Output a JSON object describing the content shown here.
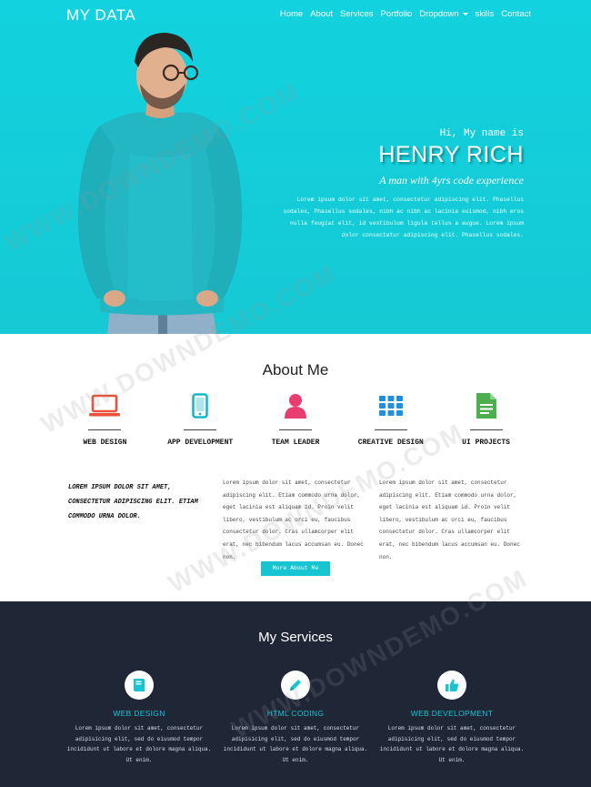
{
  "brand": "MY DATA",
  "nav": [
    {
      "label": "Home"
    },
    {
      "label": "About"
    },
    {
      "label": "Services"
    },
    {
      "label": "Portfolio"
    },
    {
      "label": "Dropdown"
    },
    {
      "label": "skills"
    },
    {
      "label": "Contact"
    }
  ],
  "hero": {
    "greeting": "Hi, My name is",
    "name": "HENRY RICH",
    "tagline": "A man with 4yrs code experience",
    "body": "Lorem ipsum dolor sit amet, consectetur adipiscing elit. Phasellus sodales, Phasellus sodales, nibh ac nibh ac lacinia euismod, nibh eros nulla feugiat elit, id vestibulum ligula tellus a augue. Lorem ipsum dolor consectetur adipiscing elit. Phasellus sodales."
  },
  "about": {
    "title": "About Me",
    "skills": [
      {
        "label": "WEB DESIGN",
        "icon": "laptop-icon",
        "color": "#e8523a"
      },
      {
        "label": "APP DEVELOPMENT",
        "icon": "smartphone-icon",
        "color": "#19b8c9"
      },
      {
        "label": "TEAM LEADER",
        "icon": "user-icon",
        "color": "#e83d6f"
      },
      {
        "label": "CREATIVE DESIGN",
        "icon": "grid-icon",
        "color": "#1f8fdf"
      },
      {
        "label": "UI PROJECTS",
        "icon": "document-icon",
        "color": "#4cae4f"
      }
    ],
    "lead": "LOREM IPSUM DOLOR SIT AMET, CONSECTETUR ADIPISCING ELIT. ETIAM COMMODO URNA DOLOR.",
    "col1": "Lorem ipsum dolor sit amet, consectetur adipiscing elit. Etiam commodo urna dolor, eget lacinia est aliquam id. Proin velit libero, vestibulum ac orci eu, faucibus consectetur dolor. Cras ullamcorper elit erat, nec bibendum lacus accumsan eu. Donec non.",
    "col2": "Lorem ipsum dolor sit amet, consectetur adipiscing elit. Etiam commodo urna dolor, eget lacinia est aliquam id. Proin velit libero, vestibulum ac orci eu, faucibus consectetur dolor. Cras ullamcorper elit erat, nec bibendum lacus accumsan eu. Donec non.",
    "button": "More About Me"
  },
  "services": {
    "title": "My Services",
    "items": [
      {
        "title": "WEB DESIGN",
        "icon": "book-icon",
        "body": "Lorem ipsum dolor sit amet, consectetur adipisicing elit, sed do eiusmod tempor incididunt ut labore et dolore magna aliqua. Ut enim."
      },
      {
        "title": "HTML CODING",
        "icon": "pencil-icon",
        "body": "Lorem ipsum dolor sit amet, consectetur adipisicing elit, sed do eiusmod tempor incididunt ut labore et dolore magna aliqua. Ut enim."
      },
      {
        "title": "WEB DEVELOPMENT",
        "icon": "thumbs-up-icon",
        "body": "Lorem ipsum dolor sit amet, consectetur adipisicing elit, sed do eiusmod tempor incididunt ut labore et dolore magna aliqua. Ut enim."
      }
    ]
  },
  "colors": {
    "accent": "#17c4d2",
    "hero_bg": "#13cfdb",
    "services_bg": "#1f2737"
  },
  "watermark": "WWW.DOWNDEMO.COM"
}
